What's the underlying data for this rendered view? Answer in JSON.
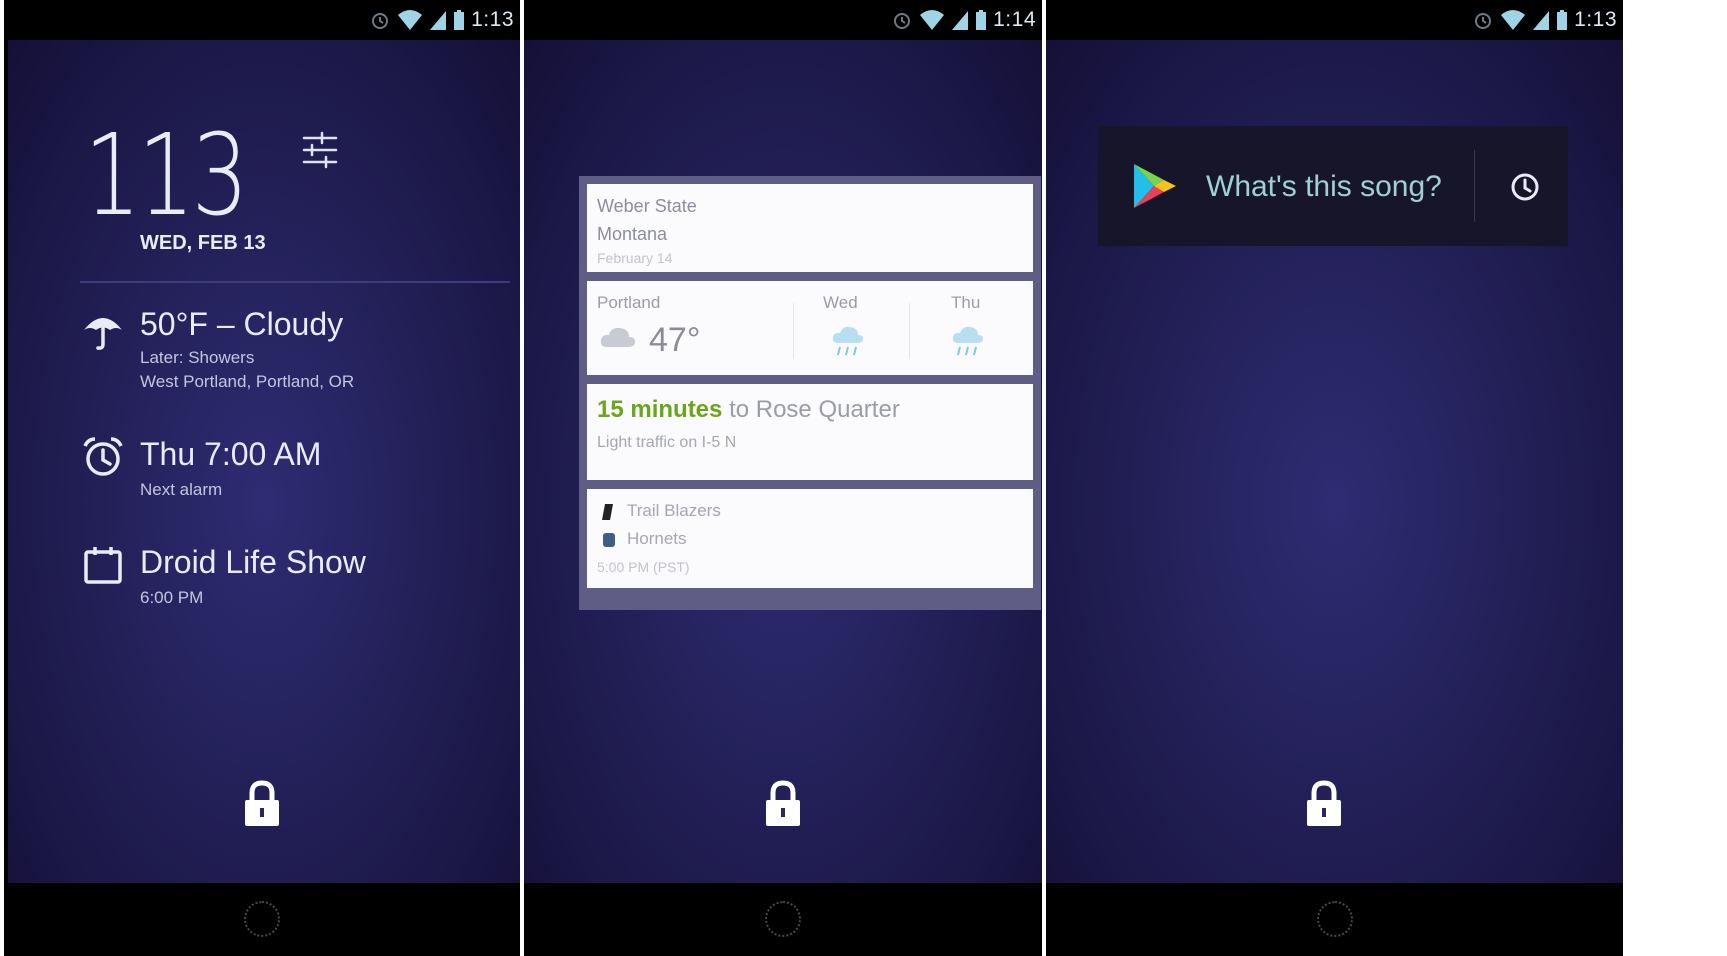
{
  "status_bar": {
    "left_phone_time": "1:13",
    "middle_phone_time": "1:14",
    "right_phone_time": "1:13"
  },
  "lockscreen_clock": {
    "time": "113",
    "date": "WED, FEB 13"
  },
  "weather": {
    "headline": "50°F – Cloudy",
    "detail_later": "Later: Showers",
    "location": "West Portland, Portland, OR"
  },
  "alarm": {
    "time": "Thu 7:00 AM",
    "label": "Next alarm"
  },
  "calendar_event": {
    "title": "Droid Life Show",
    "time": "6:00 PM"
  },
  "google_now_cards": {
    "sports_game": {
      "team_1": "Weber State",
      "team_2": "Montana",
      "date": "February 14"
    },
    "weather_card": {
      "city": "Portland",
      "current_temp": "47°",
      "day_1": "Wed",
      "day_2": "Thu"
    },
    "traffic_card": {
      "minutes": "15 minutes",
      "destination": "to Rose Quarter",
      "traffic_note": "Light traffic on I-5 N"
    },
    "nba_game_card": {
      "team_1": "Trail Blazers",
      "team_2": "Hornets",
      "time": "5:00 PM (PST)"
    }
  },
  "sound_search_widget": {
    "prompt": "What's this song?"
  },
  "colors": {
    "traffic_minutes": "#6aa51a",
    "accent_teal": "#9fd0d6"
  },
  "icons": [
    "alarm-icon",
    "wifi-icon",
    "signal-icon",
    "battery-icon",
    "settings-sliders-icon",
    "umbrella-icon",
    "alarm-clock-icon",
    "calendar-icon",
    "lock-icon",
    "home-button-icon",
    "play-store-icon",
    "history-icon",
    "cloud-icon",
    "rain-icon",
    "basketball-team-icon"
  ]
}
